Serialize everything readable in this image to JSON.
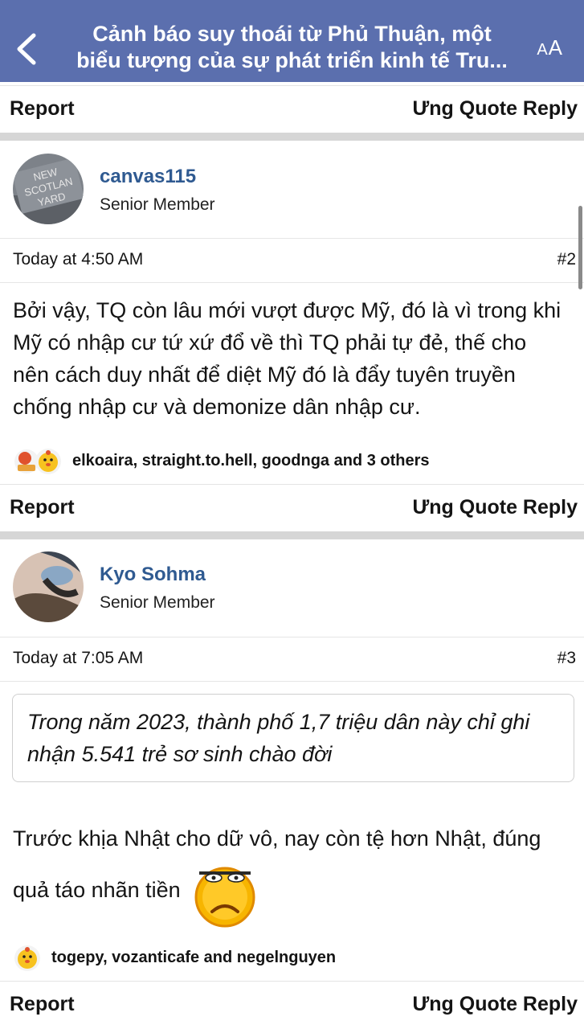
{
  "header": {
    "title_line1": "Cảnh báo suy thoái từ Phủ Thuận, một",
    "title_line2": "biểu tượng của sự phát triển kinh tế Tru...",
    "font_size_label_big": "A",
    "font_size_label_small": "A"
  },
  "actions": {
    "report": "Report",
    "right": "Ưng Quote Reply"
  },
  "posts": [
    {
      "username": "canvas115",
      "role": "Senior Member",
      "avatar_text": [
        "NEW",
        "SCOTLAN",
        "YARD"
      ],
      "time": "Today at 4:50 AM",
      "number": "#2",
      "body": "Bởi vậy, TQ còn lâu mới vượt được Mỹ, đó là vì trong khi Mỹ có nhập cư tứ xứ đổ về thì TQ phải tự đẻ, thế cho nên cách duy nhất để diệt Mỹ đó là đẩy tuyên truyền chống nhập cư và demonize dân nhập cư.",
      "reactions": "elkoaira, straight.to.hell, goodnga and 3 others"
    },
    {
      "username": "Kyo Sohma",
      "role": "Senior Member",
      "time": "Today at 7:05 AM",
      "number": "#3",
      "quote": "Trong năm 2023, thành phố 1,7 triệu dân này chỉ ghi nhận 5.541 trẻ sơ sinh chào đời",
      "body": "Trước khịa Nhật cho dữ vô, nay còn tệ hơn Nhật, đúng quả táo nhãn tiền",
      "reactions": "togepy, vozanticafe and negelnguyen"
    }
  ]
}
